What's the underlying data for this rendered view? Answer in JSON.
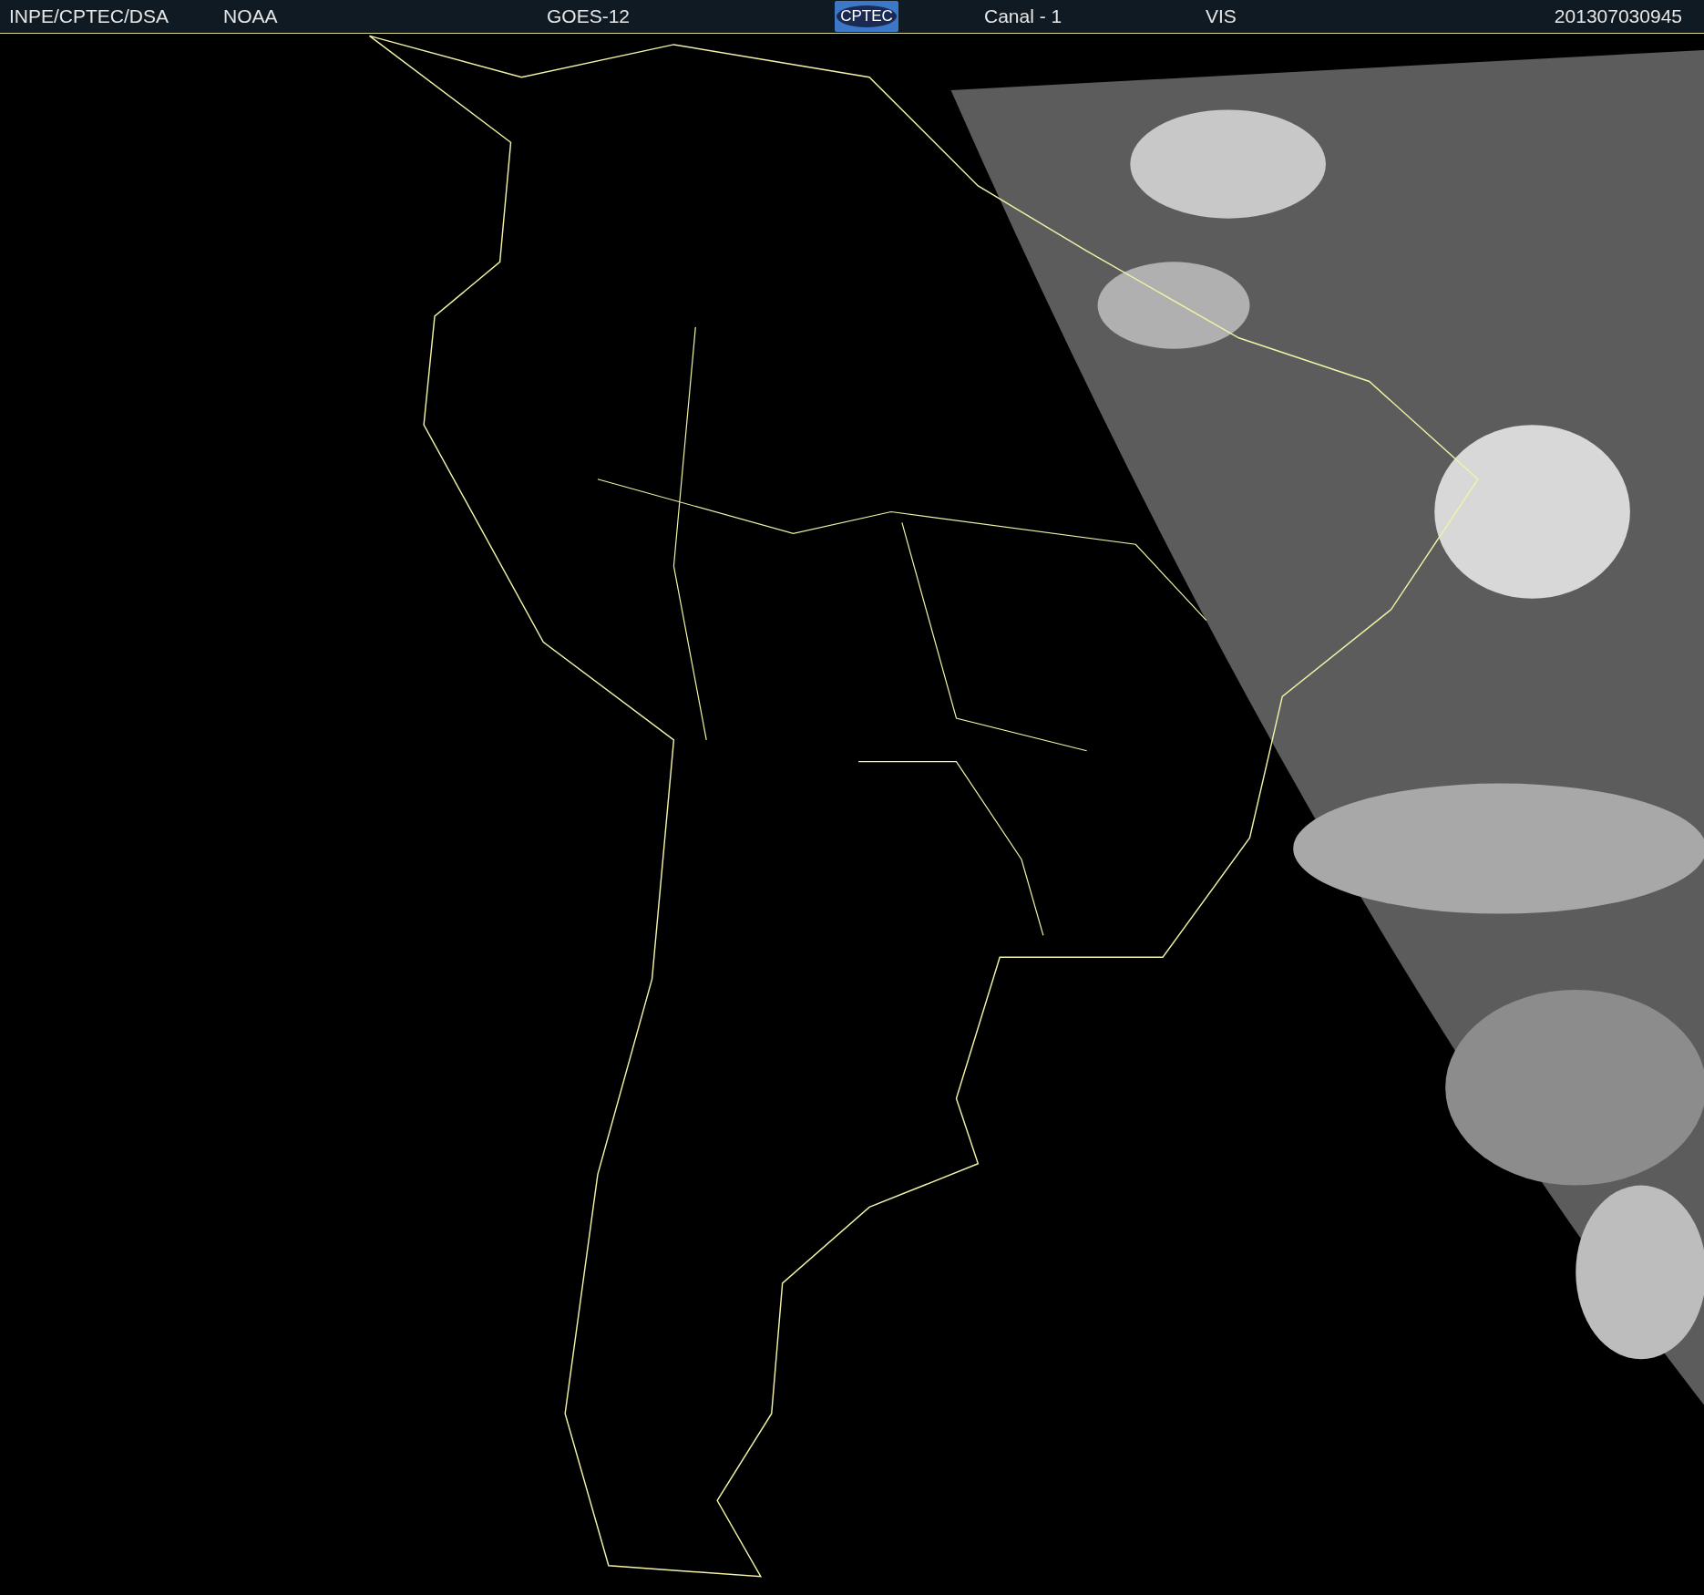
{
  "header": {
    "source": "INPE/CPTEC/DSA",
    "agency": "NOAA",
    "satellite": "GOES-12",
    "logo": "CPTEC",
    "channel": "Canal - 1",
    "band": "VIS",
    "timestamp": "201307030945"
  }
}
